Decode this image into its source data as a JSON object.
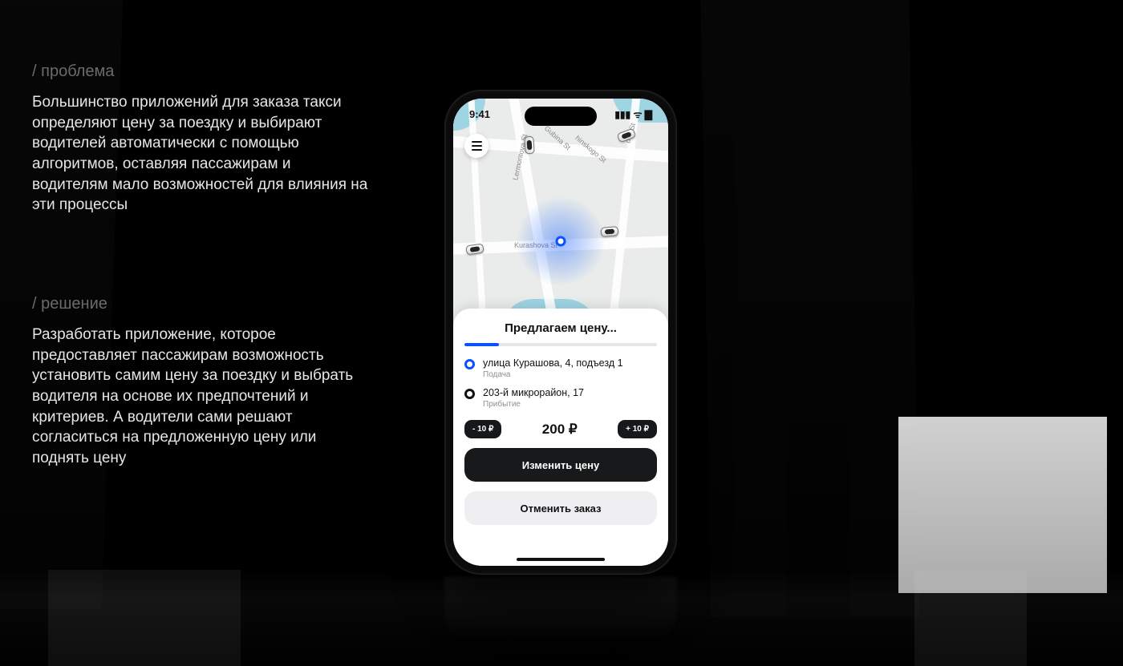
{
  "copy": {
    "problem": {
      "heading": "/ проблема",
      "body": "Большинство приложений для заказа такси определяют цену за поездку и выбирают водителей автоматически с помощью алгоритмов, оставляя пассажирам и водителям мало возможностей для влияния на эти процессы"
    },
    "solution": {
      "heading": "/ решение",
      "body": "Разработать приложение, которое предоставляет пассажирам возможность установить самим цену за поездку и выбрать водителя на основе их предпочтений и критериев. А водители сами решают согласиться на предложенную цену или поднять цену"
    }
  },
  "phone": {
    "status": {
      "time": "9:41",
      "icons": "▮▮▮ ᯤ ▇"
    },
    "map": {
      "center_label": "Kurashova St",
      "streets": {
        "lermontova": "Lermontova St",
        "gubina": "Gubina St",
        "chinskogo": "hinskogo St",
        "ova": "ova St",
        "kurashova": "Kurashova St"
      }
    },
    "sheet": {
      "title": "Предлагаем цену...",
      "progress_percent": 18,
      "origin": {
        "line1": "улица Курашова, 4, подъезд 1",
        "line2": "Подача"
      },
      "destination": {
        "line1": "203-й микрорайон, 17",
        "line2": "Прибытие"
      },
      "decrement_label": "- 10 ₽",
      "increment_label": "+ 10 ₽",
      "price_value": "200 ₽",
      "primary_button": "Изменить цену",
      "secondary_button": "Отменить заказ"
    }
  }
}
